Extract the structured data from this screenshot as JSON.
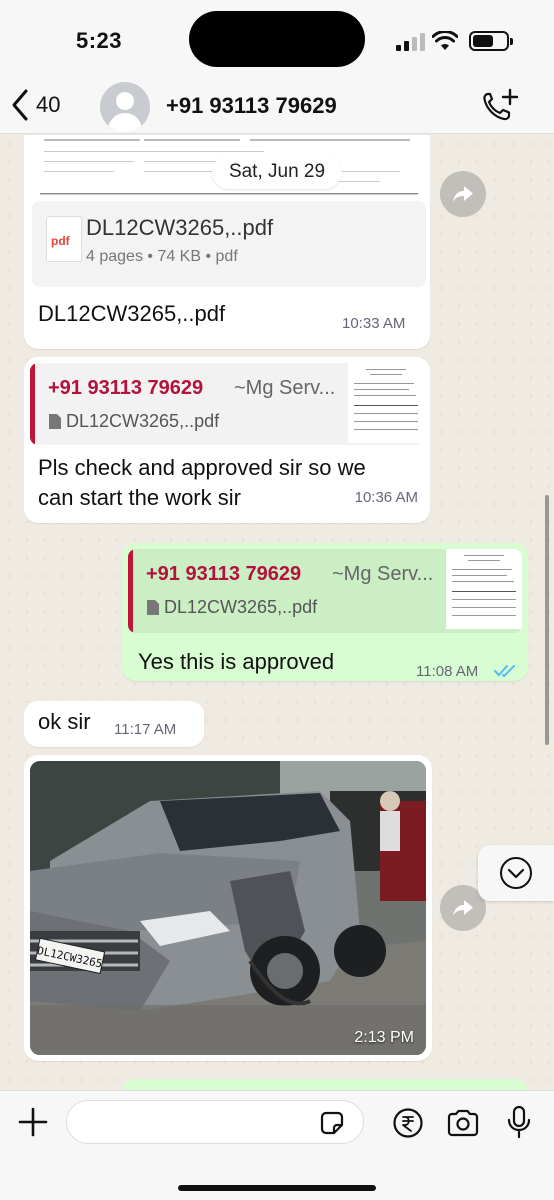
{
  "status_bar": {
    "time": "5:23"
  },
  "header": {
    "back_count": "40",
    "contact_name": "+91 93113 79629",
    "icons": [
      "chevron-left-icon",
      "avatar-placeholder-icon",
      "call-add-icon"
    ]
  },
  "chat": {
    "date_label": "Sat, Jun 29",
    "messages": [
      {
        "direction": "in",
        "type": "document",
        "file_name": "DL12CW3265,..pdf",
        "file_icon_text": "pdf",
        "pages": "4 pages",
        "size": "74 KB",
        "ext": "pdf",
        "caption": "DL12CW3265,..pdf",
        "time": "10:33 AM"
      },
      {
        "direction": "in",
        "type": "reply",
        "quote_sender": "+91 93113 79629",
        "quote_pushname": "~Mg Serv...",
        "quote_file": "DL12CW3265,..pdf",
        "text_line1": "Pls check and approved sir so we",
        "text_line2": "can start the work sir",
        "time": "10:36 AM"
      },
      {
        "direction": "out",
        "type": "reply",
        "quote_sender": "+91 93113 79629",
        "quote_pushname": "~Mg Serv...",
        "quote_file": "DL12CW3265,..pdf",
        "text": "Yes this is approved",
        "time": "11:08 AM",
        "status": "read"
      },
      {
        "direction": "in",
        "type": "text",
        "text": "ok sir",
        "time": "11:17 AM"
      },
      {
        "direction": "in",
        "type": "image",
        "license_plate": "DL12CW3265",
        "time": "2:13 PM"
      }
    ]
  },
  "input_bar": {
    "placeholder": "",
    "icons": [
      "plus-icon",
      "sticker-icon",
      "rupee-icon",
      "camera-icon",
      "mic-icon"
    ]
  },
  "colors": {
    "chat_background": "#efeae2",
    "incoming_bubble": "#ffffff",
    "outgoing_bubble": "#d9fdd3",
    "quote_accent": "#c0143c",
    "read_ticks": "#53bdeb"
  }
}
